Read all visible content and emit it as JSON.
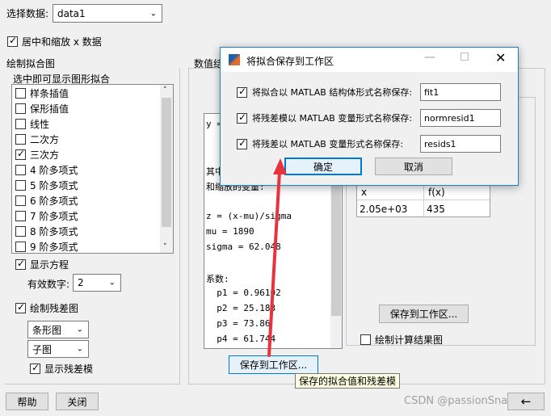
{
  "main": {
    "select_data_label": "选择数据:",
    "select_data_value": "data1",
    "center_scale_label": "居中和缩放 x 数据",
    "plot_fit_group_title": "绘制拟合图",
    "plot_fit_hint": "选中即可显示图形拟合",
    "fit_types": [
      {
        "label": "样条插值",
        "checked": false
      },
      {
        "label": "保形插值",
        "checked": false
      },
      {
        "label": "线性",
        "checked": false
      },
      {
        "label": "二次方",
        "checked": false
      },
      {
        "label": "三次方",
        "checked": true
      },
      {
        "label": "4 阶多项式",
        "checked": false
      },
      {
        "label": "5 阶多项式",
        "checked": false
      },
      {
        "label": "6 阶多项式",
        "checked": false
      },
      {
        "label": "7 阶多项式",
        "checked": false
      },
      {
        "label": "8 阶多项式",
        "checked": false
      },
      {
        "label": "9 阶多项式",
        "checked": false
      }
    ],
    "show_equation_label": "显示方程",
    "sig_digits_label": "有效数字:",
    "sig_digits_value": "2",
    "plot_residuals_label": "绘制残差图",
    "residual_type_value": "条形图",
    "residual_location_value": "子图",
    "show_norm_residual_label": "显示残差模",
    "help_label": "帮助",
    "close_label": "关闭",
    "numeric_results_title": "数值结",
    "code_lines": [
      "y =",
      "",
      "",
      "其中",
      "和缩放的变量:",
      "",
      "z = (x-mu)/sigma",
      "mu = 1890",
      "sigma = 62.048",
      "",
      "系数:",
      "  p1 = 0.96102",
      "  p2 = 25.183",
      "  p3 = 73.86",
      "  p4 = 61.744"
    ],
    "save_to_workspace_label": "保存到工作区...",
    "tooltip": "保存的拟合值和残差模",
    "eval_table_headers": [
      "x",
      "f(x)"
    ],
    "eval_table_row": [
      "2.05e+03",
      "435"
    ],
    "save_results_label": "保存到工作区...",
    "plot_eval_label": "绘制计算结果图",
    "watermark": "CSDN @passionSnail",
    "back_arrow": "←"
  },
  "dialog": {
    "title": "将拟合保存到工作区",
    "fields": [
      {
        "label": "将拟合以 MATLAB 结构体形式名称保存:",
        "value": "fit1",
        "checked": true
      },
      {
        "label": "将残差模以 MATLAB 变量形式名称保存:",
        "value": "normresid1",
        "checked": true
      },
      {
        "label": "将残差以 MATLAB 变量形式名称保存:",
        "value": "resids1",
        "checked": true
      }
    ],
    "ok_label": "确定",
    "cancel_label": "取消"
  },
  "colors": {
    "annotation_arrow": "#e8323c",
    "dialog_accent": "#0a67c9"
  }
}
